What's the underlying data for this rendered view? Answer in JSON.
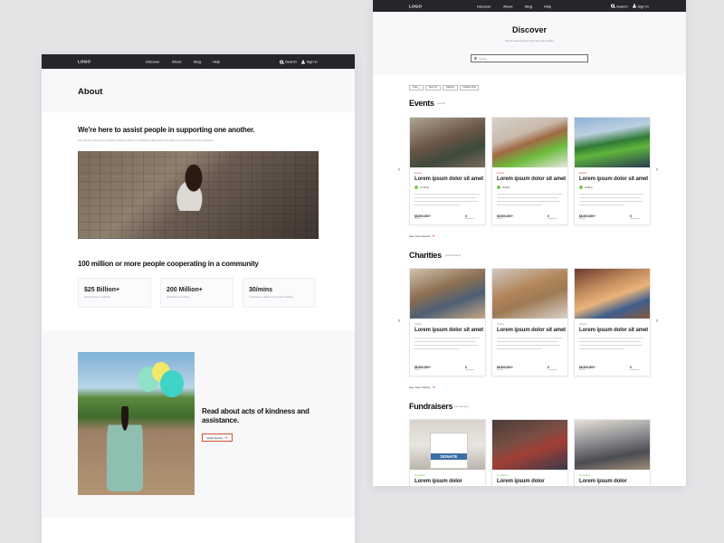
{
  "nav": {
    "logo": "LOGO",
    "items": [
      "Discover",
      "About",
      "Blog",
      "Help"
    ],
    "search": "Search",
    "sign_in": "Sign in"
  },
  "about_page": {
    "title": "About",
    "assist_heading": "We're here to assist people in supporting one another.",
    "assist_text": "Let's turn this company to a powerful, which is relevant so standing to make and do this earlier on to growth and receive, generous.",
    "stats_heading": "100 million or more people cooperating in a community",
    "stats": [
      {
        "value": "$25 Billion+",
        "label": "raised by donors worldwide"
      },
      {
        "value": "200 Million+",
        "label": "donations and counting"
      },
      {
        "value": "30/mins",
        "label": "a fundraiser is started every minute worldwide"
      }
    ],
    "kindness_heading": "Read about acts of kindness and assistance.",
    "read_stories": "Read Stories"
  },
  "discover_page": {
    "title": "Discover",
    "subtitle": "Get the causes that are in the area, communities",
    "search_placeholder": "Search",
    "filters": [
      "Date",
      "Near You",
      "Category",
      "Charities Chal"
    ],
    "events": {
      "heading": "Events",
      "count": "(count)",
      "see_more": "See more Events",
      "cards": [
        {
          "category": "Events",
          "title": "Lorem ipsum dolor sit amet",
          "badge": "Go Flash",
          "amount": "$8,500,000+",
          "amount_label": "Raised",
          "num": "9",
          "num_label": "Supporters"
        },
        {
          "category": "Events",
          "title": "Lorem ipsum dolor sit amet",
          "badge": "Verified",
          "amount": "$8,500,000+",
          "amount_label": "Raised",
          "num": "9",
          "num_label": "Supporters"
        },
        {
          "category": "Events",
          "title": "Lorem ipsum dolor sit amet",
          "badge": "Verified",
          "amount": "$8,500,000+",
          "amount_label": "Raised",
          "num": "9",
          "num_label": "Supporters"
        }
      ]
    },
    "charities": {
      "heading": "Charities",
      "count": "(All charities)",
      "see_more": "See more Charity",
      "cards": [
        {
          "category": "Charity",
          "title": "Lorem ipsum dolor sit amet",
          "amount": "$8,500,000+",
          "amount_label": "Raised",
          "num": "9",
          "num_label": "Supporters"
        },
        {
          "category": "Charity",
          "title": "Lorem ipsum dolor sit amet",
          "amount": "$8,500,000+",
          "amount_label": "Raised",
          "num": "9",
          "num_label": "Supporters"
        },
        {
          "category": "Charity",
          "title": "Lorem ipsum dolor sit amet",
          "amount": "$8,500,000+",
          "amount_label": "Raised",
          "num": "9",
          "num_label": "Supporters"
        }
      ]
    },
    "fundraisers": {
      "heading": "Fundraisers",
      "count": "(All causes)",
      "cards": [
        {
          "category": "Fundraiser",
          "title": "Lorem ipsum dolor"
        },
        {
          "category": "Fundraiser",
          "title": "Lorem ipsum dolor"
        },
        {
          "category": "Fundraiser",
          "title": "Lorem ipsum dolor"
        }
      ],
      "donate_box_label": "DONATE"
    }
  },
  "colors": {
    "nav_bg": "#26262a",
    "accent": "#d25235",
    "verified": "#7bc94a"
  },
  "icons": [
    "search-icon",
    "user-icon",
    "chevron-left-icon",
    "chevron-right-icon",
    "arrow-right-icon",
    "check-badge-icon",
    "chevron-down-icon"
  ]
}
